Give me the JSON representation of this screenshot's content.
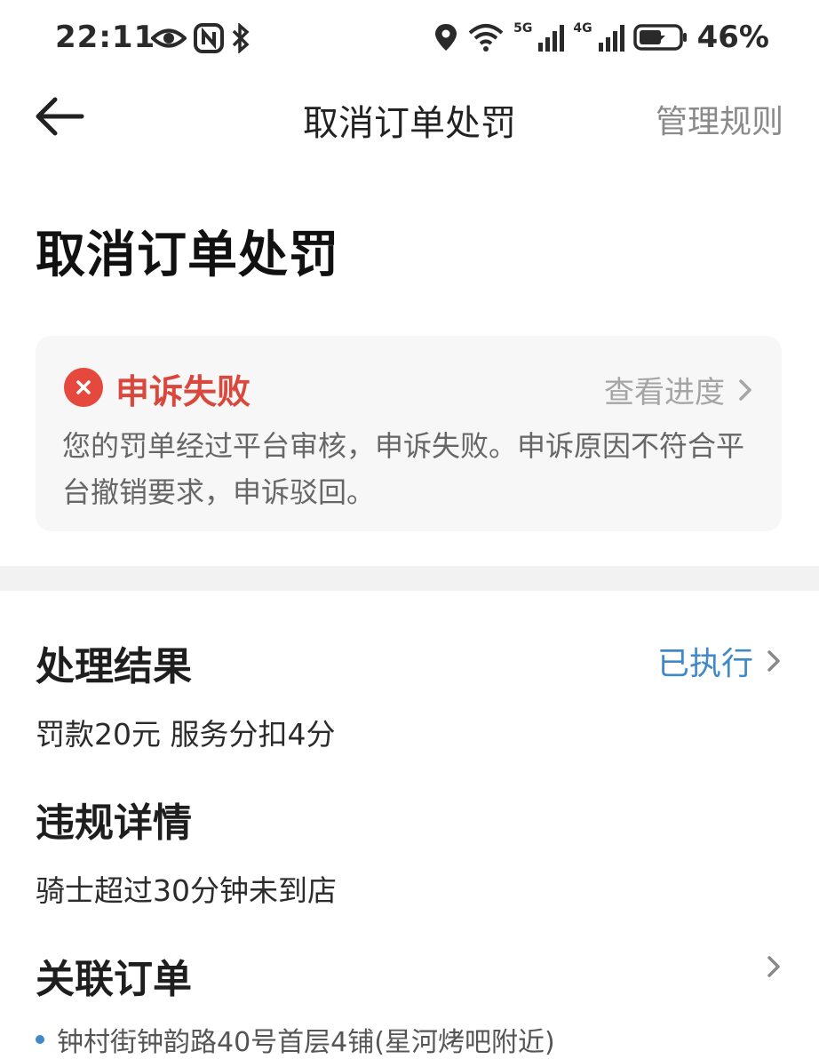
{
  "status_bar": {
    "time": "22:11",
    "battery_percent": "46%",
    "signal_5g_label": "5G",
    "signal_4g_label": "4G",
    "icons": [
      "eye-icon",
      "nfc-icon",
      "bluetooth-icon",
      "location-icon",
      "wifi-icon",
      "signal-5g-icon",
      "signal-4g-icon",
      "battery-charging-icon"
    ]
  },
  "header": {
    "title": "取消订单处罚",
    "action_label": "管理规则"
  },
  "page": {
    "heading": "取消订单处罚"
  },
  "appeal": {
    "status_label": "申诉失败",
    "progress_link": "查看进度",
    "description": "您的罚单经过平台审核，申诉失败。申诉原因不符合平台撤销要求，申诉驳回。",
    "status_color": "#e5483d"
  },
  "result": {
    "title": "处理结果",
    "status_link": "已执行",
    "detail": "罚款20元 服务分扣4分",
    "link_color": "#3f88c9"
  },
  "violation": {
    "title": "违规详情",
    "detail": "骑士超过30分钟未到店"
  },
  "order": {
    "title": "关联订单",
    "address": "钟村街钟韵路40号首层4铺(星河烤吧附近)"
  }
}
